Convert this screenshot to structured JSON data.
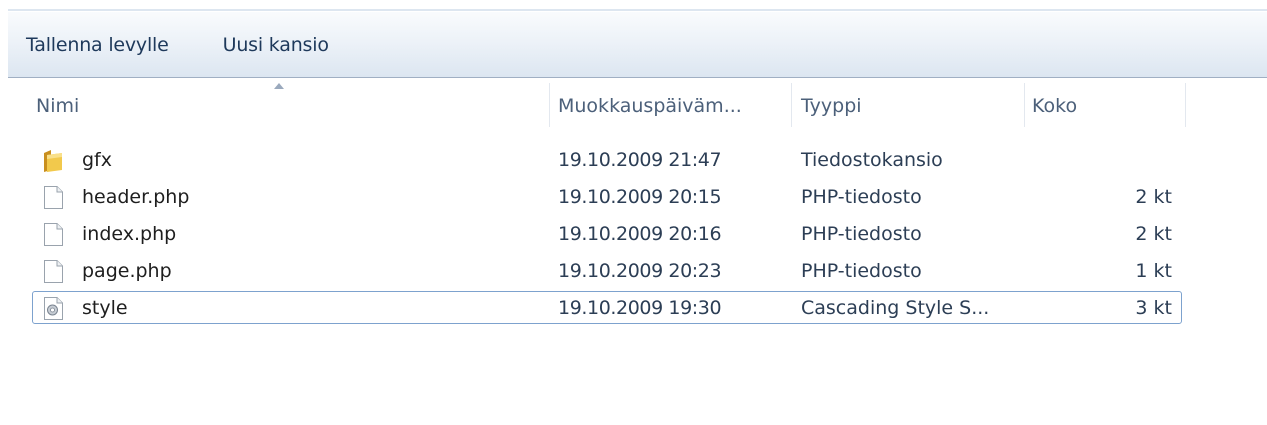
{
  "toolbar": {
    "save_label": "Tallenna levylle",
    "new_folder_label": "Uusi kansio"
  },
  "columns": {
    "name": "Nimi",
    "modified": "Muokkauspäiväm...",
    "type": "Tyyppi",
    "size": "Koko"
  },
  "files": [
    {
      "name": "gfx",
      "modified": "19.10.2009 21:47",
      "type": "Tiedostokansio",
      "size": "",
      "icon": "folder-icon"
    },
    {
      "name": "header.php",
      "modified": "19.10.2009 20:15",
      "type": "PHP-tiedosto",
      "size": "2 kt",
      "icon": "file-icon"
    },
    {
      "name": "index.php",
      "modified": "19.10.2009 20:16",
      "type": "PHP-tiedosto",
      "size": "2 kt",
      "icon": "file-icon"
    },
    {
      "name": "page.php",
      "modified": "19.10.2009 20:23",
      "type": "PHP-tiedosto",
      "size": "1 kt",
      "icon": "file-icon"
    },
    {
      "name": "style",
      "modified": "19.10.2009 19:30",
      "type": "Cascading Style S...",
      "size": "3 kt",
      "icon": "css-file-icon",
      "selected": true
    }
  ],
  "colors": {
    "toolbar_text": "#1e395b",
    "header_text": "#4c607a",
    "selection_border": "#7da2ce",
    "folder": "#e8b93a"
  }
}
